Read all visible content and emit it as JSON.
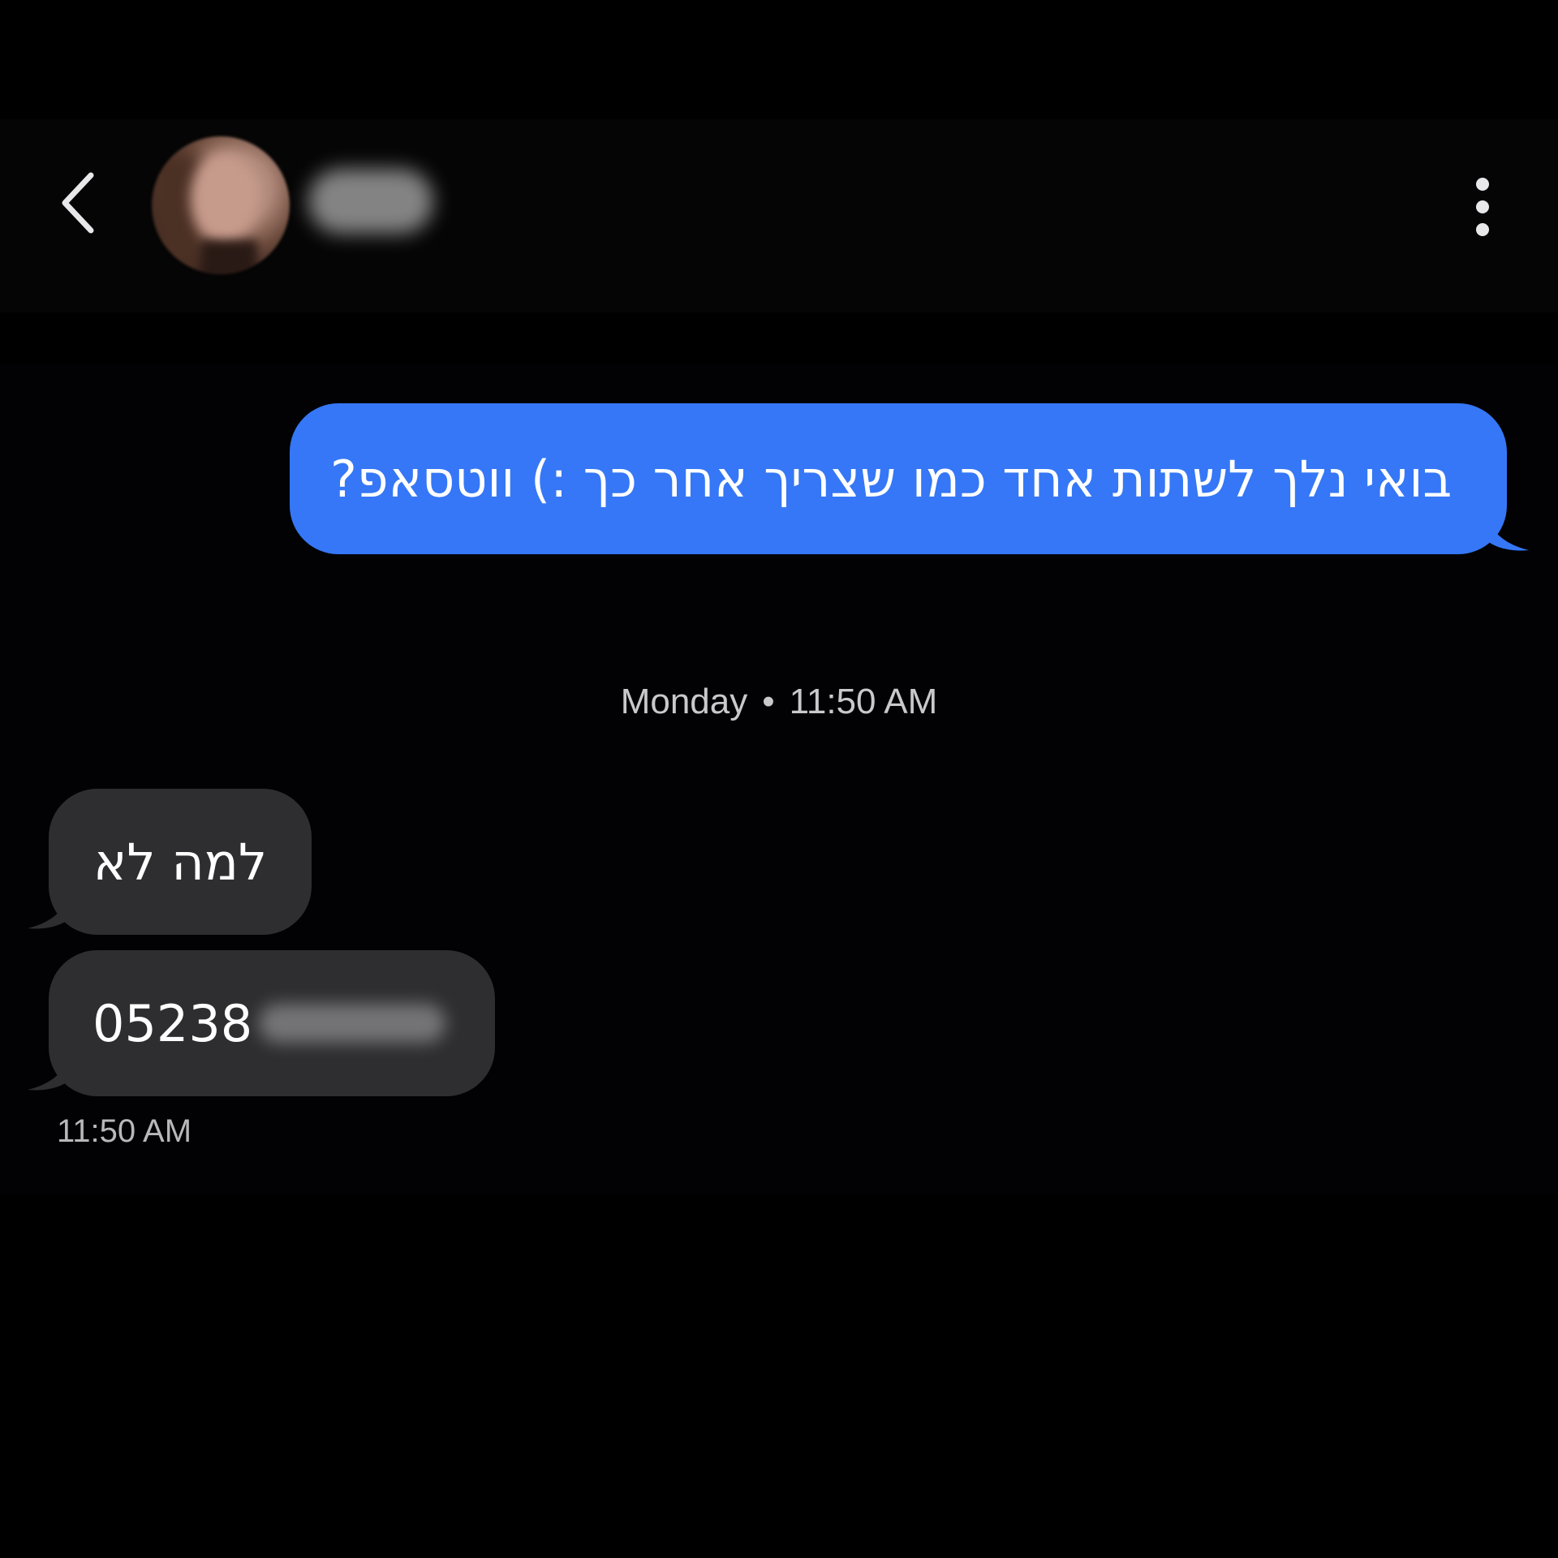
{
  "header": {
    "contact_name": "",
    "back_icon": "chevron-left-icon",
    "more_icon": "more-vertical-icon"
  },
  "messages": {
    "outgoing": [
      {
        "text": "בואי נלך לשתות אחד כמו שצריך אחר כך :) ווטסאפ?"
      }
    ],
    "divider": {
      "day": "Monday",
      "separator": "•",
      "time": "11:50 AM"
    },
    "incoming": [
      {
        "text": "למה לא"
      },
      {
        "text": "05238"
      }
    ],
    "incoming_time": "11:50 AM"
  },
  "colors": {
    "outgoing_bubble": "#3577f6",
    "incoming_bubble": "#2e2e30",
    "background": "#000000"
  }
}
